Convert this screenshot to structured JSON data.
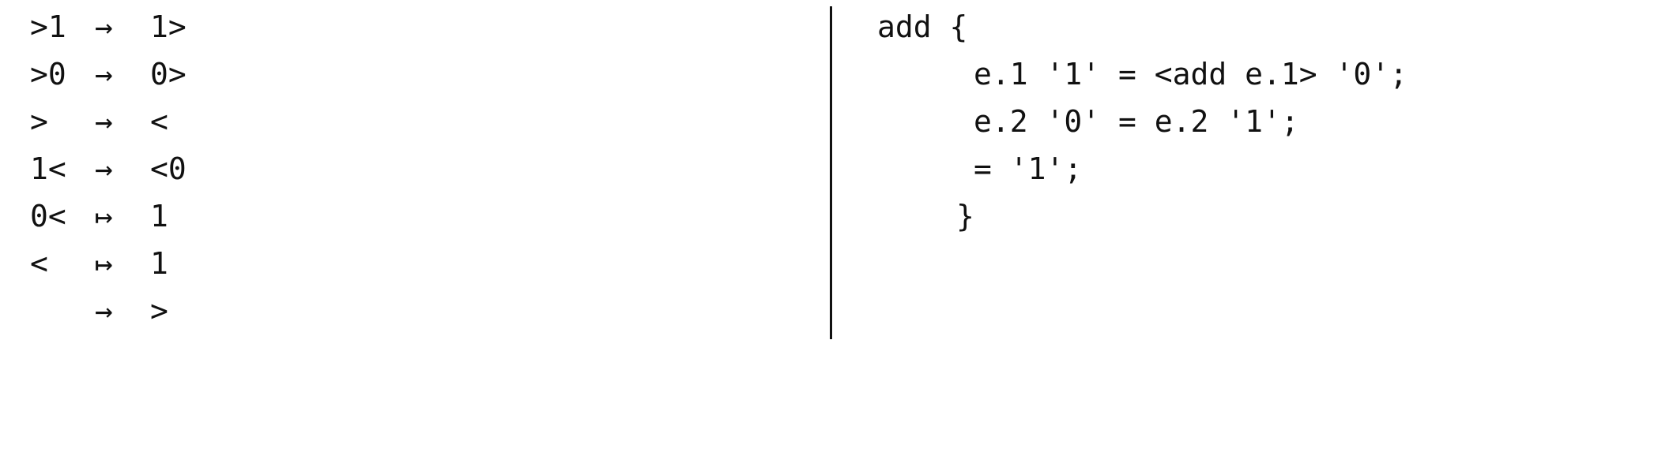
{
  "markov_rules": [
    {
      "lhs": ">1",
      "arrow": "→",
      "rhs": "1>"
    },
    {
      "lhs": ">0",
      "arrow": "→",
      "rhs": "0>"
    },
    {
      "lhs": ">",
      "arrow": "→",
      "rhs": "<"
    },
    {
      "lhs": "1<",
      "arrow": "→",
      "rhs": "<0"
    },
    {
      "lhs": "0<",
      "arrow": "↦",
      "rhs": "1"
    },
    {
      "lhs": "<",
      "arrow": "↦",
      "rhs": "1"
    },
    {
      "lhs": "",
      "arrow": "→",
      "rhs": ">"
    }
  ],
  "refal_code": [
    "add {",
    "e.1 '1' = <add e.1> '0';",
    "e.2 '0' = e.2 '1';",
    "= '1';",
    "}"
  ]
}
